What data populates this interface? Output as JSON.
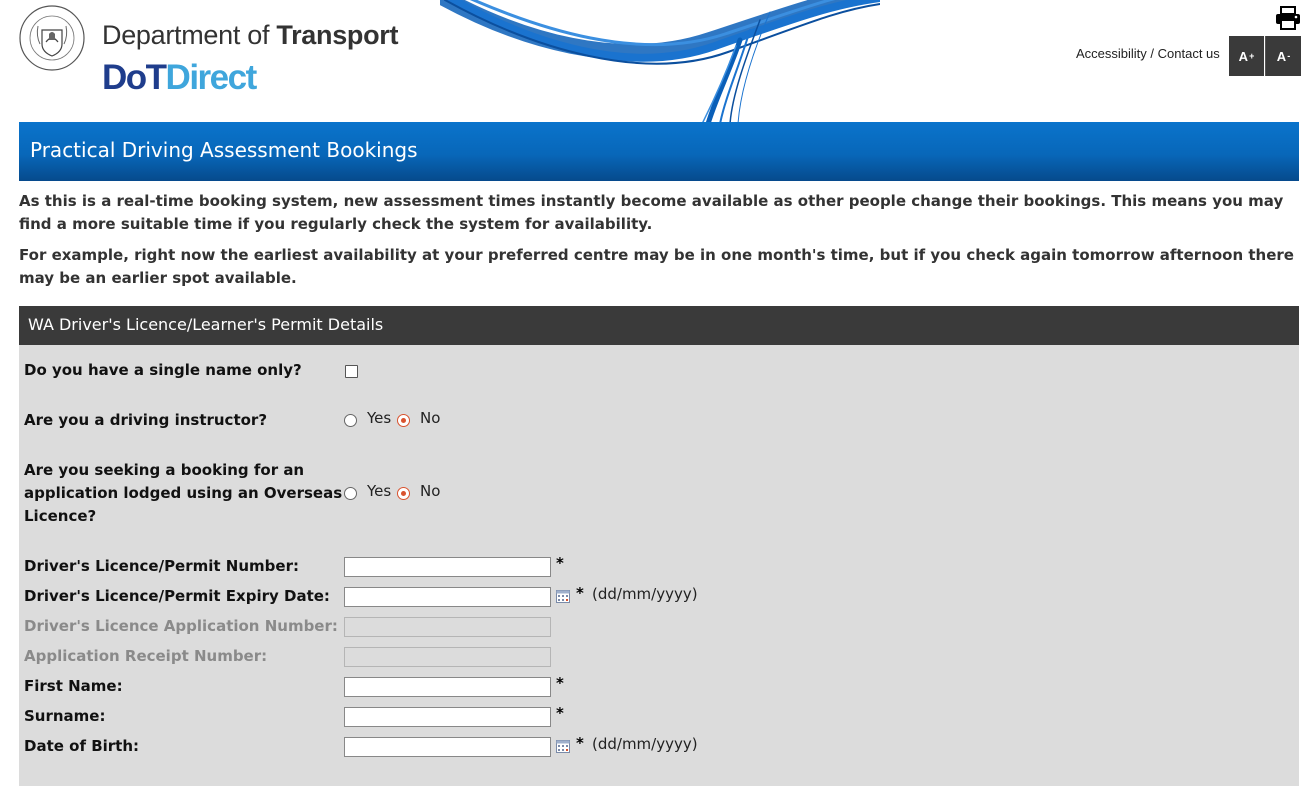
{
  "header": {
    "department_prefix": "Department of ",
    "department_bold": "Transport",
    "logo_part1": "DoT",
    "logo_part2": "Direct",
    "crest_icon": "wa-government-crest-icon",
    "print_icon": "printer-icon",
    "utility_links": {
      "accessibility": "Accessibility",
      "separator": " / ",
      "contact": "Contact us"
    },
    "font_increase": {
      "label": "A",
      "sup": "+"
    },
    "font_decrease": {
      "label": "A",
      "sup": "-"
    }
  },
  "banner": {
    "title": "Practical Driving Assessment Bookings"
  },
  "intro": {
    "p1": "As this is a real-time booking system, new assessment times instantly become available as other people change their bookings. This means you may find a more suitable time if you regularly check the system for availability.",
    "p2": "For example, right now the earliest availability at your preferred centre may be in one month's time, but if you check again tomorrow afternoon there may be an earlier spot available."
  },
  "section": {
    "title": "WA Driver's Licence/Learner's Permit Details",
    "single_name": {
      "label": "Do you have a single name only?",
      "checked": false
    },
    "instructor": {
      "label": "Are you a driving instructor?",
      "yes": "Yes",
      "no": "No",
      "selected": "No"
    },
    "overseas": {
      "label_l1": "Are you seeking a booking for an",
      "label_l2": "application lodged using an Overseas",
      "label_l3": "Licence?",
      "yes": "Yes",
      "no": "No",
      "selected": "No"
    },
    "fields": {
      "licence_number": {
        "label": "Driver's Licence/Permit Number:",
        "value": "",
        "required": "*"
      },
      "expiry_date": {
        "label": "Driver's Licence/Permit Expiry Date:",
        "value": "",
        "required": "*",
        "format": "(dd/mm/yyyy)"
      },
      "application_number": {
        "label": "Driver's Licence Application Number:",
        "value": ""
      },
      "receipt_number": {
        "label": "Application Receipt Number:",
        "value": ""
      },
      "first_name": {
        "label": "First Name:",
        "value": "",
        "required": "*"
      },
      "surname": {
        "label": "Surname:",
        "value": "",
        "required": "*"
      },
      "dob": {
        "label": "Date of Birth:",
        "value": "",
        "required": "*",
        "format": "(dd/mm/yyyy)"
      }
    }
  },
  "colors": {
    "banner_blue": "#0867b9",
    "dark_bar": "#3a3a3a",
    "panel_grey": "#dcdcdc",
    "radio_accent": "#d9532f"
  }
}
